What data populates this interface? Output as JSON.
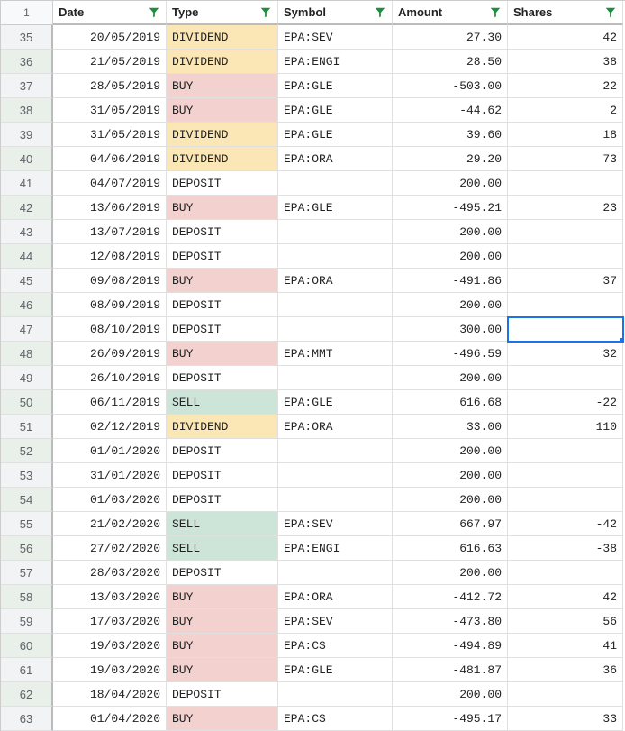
{
  "corner": "1",
  "columns": [
    "Date",
    "Type",
    "Symbol",
    "Amount",
    "Shares"
  ],
  "selected_cell": {
    "row_index": 12,
    "col": "shares"
  },
  "rows": [
    {
      "n": 35,
      "date": "20/05/2019",
      "type": "DIVIDEND",
      "symbol": "EPA:SEV",
      "amount": "27.30",
      "shares": "42"
    },
    {
      "n": 36,
      "date": "21/05/2019",
      "type": "DIVIDEND",
      "symbol": "EPA:ENGI",
      "amount": "28.50",
      "shares": "38"
    },
    {
      "n": 37,
      "date": "28/05/2019",
      "type": "BUY",
      "symbol": "EPA:GLE",
      "amount": "-503.00",
      "shares": "22"
    },
    {
      "n": 38,
      "date": "31/05/2019",
      "type": "BUY",
      "symbol": "EPA:GLE",
      "amount": "-44.62",
      "shares": "2"
    },
    {
      "n": 39,
      "date": "31/05/2019",
      "type": "DIVIDEND",
      "symbol": "EPA:GLE",
      "amount": "39.60",
      "shares": "18"
    },
    {
      "n": 40,
      "date": "04/06/2019",
      "type": "DIVIDEND",
      "symbol": "EPA:ORA",
      "amount": "29.20",
      "shares": "73"
    },
    {
      "n": 41,
      "date": "04/07/2019",
      "type": "DEPOSIT",
      "symbol": "",
      "amount": "200.00",
      "shares": ""
    },
    {
      "n": 42,
      "date": "13/06/2019",
      "type": "BUY",
      "symbol": "EPA:GLE",
      "amount": "-495.21",
      "shares": "23"
    },
    {
      "n": 43,
      "date": "13/07/2019",
      "type": "DEPOSIT",
      "symbol": "",
      "amount": "200.00",
      "shares": ""
    },
    {
      "n": 44,
      "date": "12/08/2019",
      "type": "DEPOSIT",
      "symbol": "",
      "amount": "200.00",
      "shares": ""
    },
    {
      "n": 45,
      "date": "09/08/2019",
      "type": "BUY",
      "symbol": "EPA:ORA",
      "amount": "-491.86",
      "shares": "37"
    },
    {
      "n": 46,
      "date": "08/09/2019",
      "type": "DEPOSIT",
      "symbol": "",
      "amount": "200.00",
      "shares": ""
    },
    {
      "n": 47,
      "date": "08/10/2019",
      "type": "DEPOSIT",
      "symbol": "",
      "amount": "300.00",
      "shares": ""
    },
    {
      "n": 48,
      "date": "26/09/2019",
      "type": "BUY",
      "symbol": "EPA:MMT",
      "amount": "-496.59",
      "shares": "32"
    },
    {
      "n": 49,
      "date": "26/10/2019",
      "type": "DEPOSIT",
      "symbol": "",
      "amount": "200.00",
      "shares": ""
    },
    {
      "n": 50,
      "date": "06/11/2019",
      "type": "SELL",
      "symbol": "EPA:GLE",
      "amount": "616.68",
      "shares": "-22"
    },
    {
      "n": 51,
      "date": "02/12/2019",
      "type": "DIVIDEND",
      "symbol": "EPA:ORA",
      "amount": "33.00",
      "shares": "110"
    },
    {
      "n": 52,
      "date": "01/01/2020",
      "type": "DEPOSIT",
      "symbol": "",
      "amount": "200.00",
      "shares": ""
    },
    {
      "n": 53,
      "date": "31/01/2020",
      "type": "DEPOSIT",
      "symbol": "",
      "amount": "200.00",
      "shares": ""
    },
    {
      "n": 54,
      "date": "01/03/2020",
      "type": "DEPOSIT",
      "symbol": "",
      "amount": "200.00",
      "shares": ""
    },
    {
      "n": 55,
      "date": "21/02/2020",
      "type": "SELL",
      "symbol": "EPA:SEV",
      "amount": "667.97",
      "shares": "-42"
    },
    {
      "n": 56,
      "date": "27/02/2020",
      "type": "SELL",
      "symbol": "EPA:ENGI",
      "amount": "616.63",
      "shares": "-38"
    },
    {
      "n": 57,
      "date": "28/03/2020",
      "type": "DEPOSIT",
      "symbol": "",
      "amount": "200.00",
      "shares": ""
    },
    {
      "n": 58,
      "date": "13/03/2020",
      "type": "BUY",
      "symbol": "EPA:ORA",
      "amount": "-412.72",
      "shares": "42"
    },
    {
      "n": 59,
      "date": "17/03/2020",
      "type": "BUY",
      "symbol": "EPA:SEV",
      "amount": "-473.80",
      "shares": "56"
    },
    {
      "n": 60,
      "date": "19/03/2020",
      "type": "BUY",
      "symbol": "EPA:CS",
      "amount": "-494.89",
      "shares": "41"
    },
    {
      "n": 61,
      "date": "19/03/2020",
      "type": "BUY",
      "symbol": "EPA:GLE",
      "amount": "-481.87",
      "shares": "36"
    },
    {
      "n": 62,
      "date": "18/04/2020",
      "type": "DEPOSIT",
      "symbol": "",
      "amount": "200.00",
      "shares": ""
    },
    {
      "n": 63,
      "date": "01/04/2020",
      "type": "BUY",
      "symbol": "EPA:CS",
      "amount": "-495.17",
      "shares": "33"
    }
  ]
}
